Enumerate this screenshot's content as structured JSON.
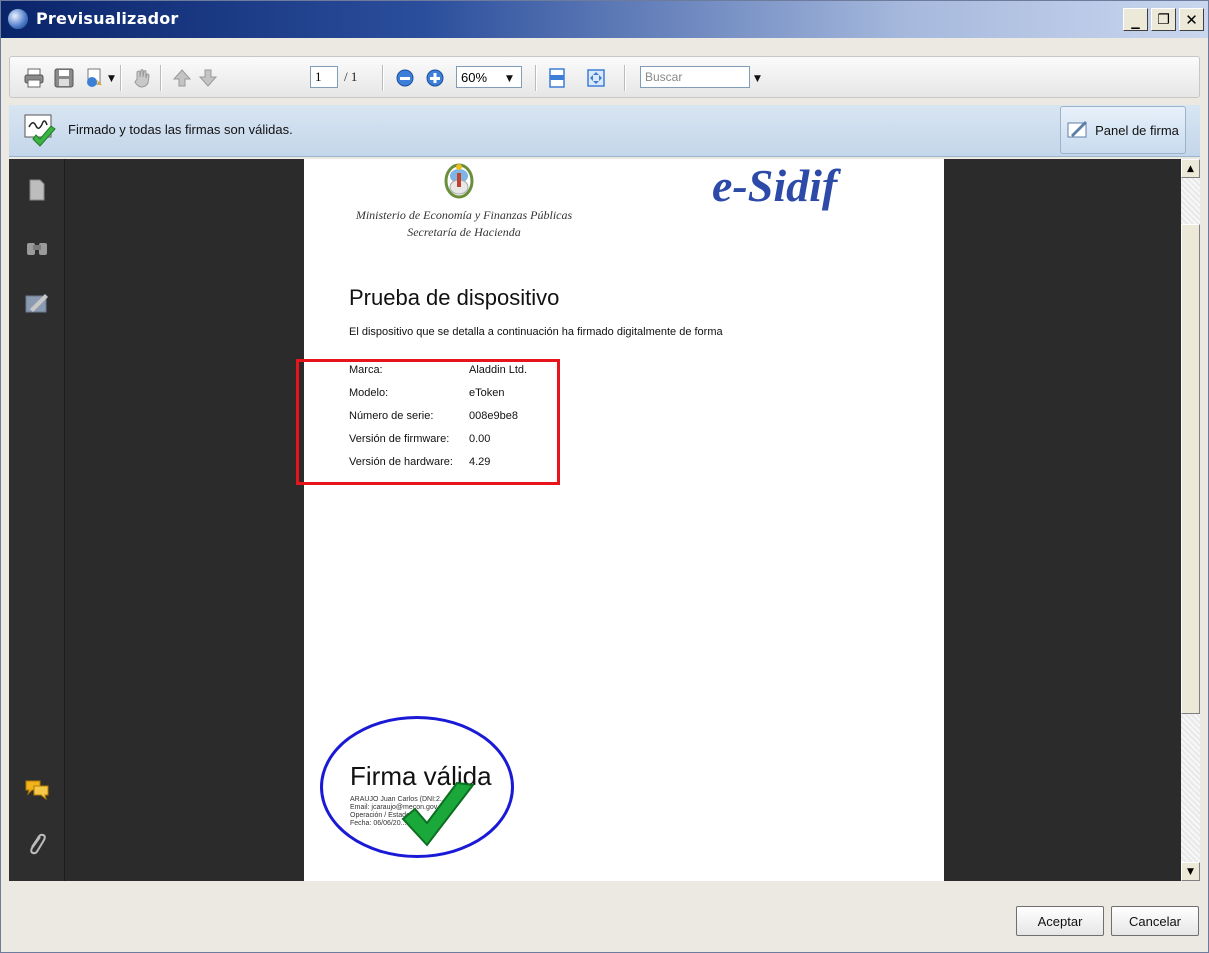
{
  "window": {
    "title": "Previsualizador",
    "minimize_label": "_",
    "restore_label": "❐",
    "close_label": "✕"
  },
  "toolbar": {
    "page_current": "1",
    "page_total": "/ 1",
    "zoom_value": "60%",
    "search_placeholder": "Buscar",
    "icons": [
      "print-icon",
      "save-icon",
      "export-icon",
      "hand-icon",
      "prev-page-icon",
      "next-page-icon",
      "zoom-out-icon",
      "zoom-in-icon",
      "fit-width-icon",
      "fit-page-icon"
    ]
  },
  "signature_bar": {
    "status_text": "Firmado y todas las firmas son válidas.",
    "panel_button_label": "Panel de firma"
  },
  "left_panel": {
    "icons": [
      "pages-icon",
      "search-binoculars-icon",
      "signatures-icon",
      "comments-icon",
      "attachments-icon"
    ]
  },
  "document": {
    "ministry_line1": "Ministerio de Economía y Finanzas Públicas",
    "ministry_line2": "Secretaría de Hacienda",
    "logo_text": "e-Sidif",
    "title": "Prueba de dispositivo",
    "intro": "El dispositivo que se detalla a continuación ha firmado digitalmente de forma",
    "rows": [
      {
        "label": "Marca:",
        "value": "Aladdin Ltd."
      },
      {
        "label": "Modelo:",
        "value": "eToken"
      },
      {
        "label": "Número de serie:",
        "value": "008e9be8"
      },
      {
        "label": "Versión de firmware:",
        "value": "0.00"
      },
      {
        "label": "Versión de hardware:",
        "value": "4.29"
      }
    ],
    "signature_title": "Firma válida",
    "signature_line1": "ARAUJO Juan Carlos (DNI:2...002)",
    "signature_line2": "Email: jcaraujo@mecon.gov.ar",
    "signature_line3": "Operación / Estado",
    "signature_line4": "Fecha: 06/06/20..."
  },
  "footer": {
    "accept_label": "Aceptar",
    "cancel_label": "Cancelar"
  },
  "colors": {
    "highlight_red": "#e8141b",
    "highlight_blue": "#1a1ad6",
    "check_green": "#1aa83a"
  }
}
